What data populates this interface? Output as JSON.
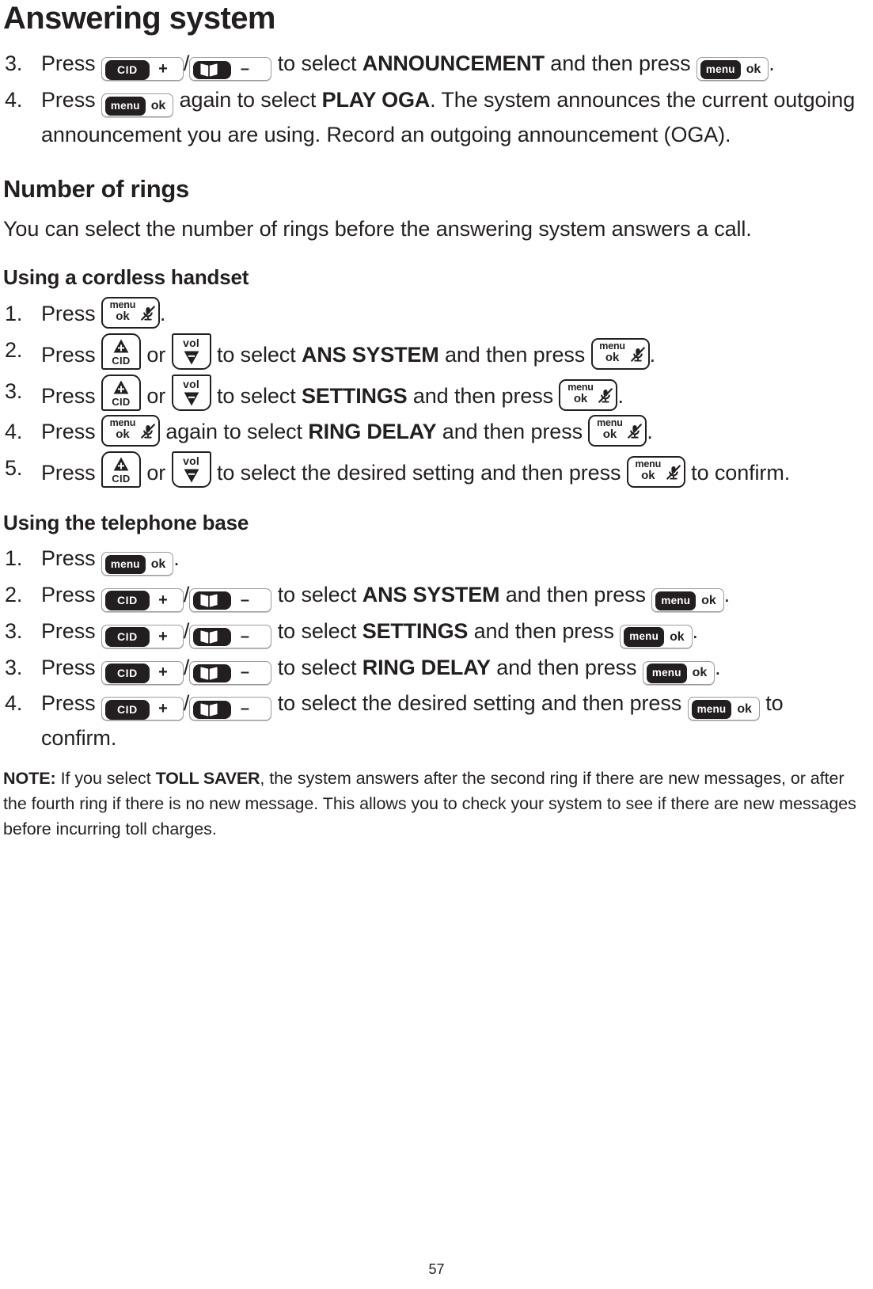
{
  "document": {
    "title": "Answering system",
    "page_number": "57"
  },
  "keys": {
    "base_cid_plus": {
      "chip_label": "CID",
      "sign": "+",
      "name": "base-cid-up-key"
    },
    "base_dir_minus": {
      "chip_icon": "open-book-icon",
      "sign": "–",
      "name": "base-directory-down-key"
    },
    "base_menu_ok": {
      "chip_label": "menu",
      "ok_label": "ok",
      "name": "base-menu-ok-key"
    },
    "handset_menu_ok": {
      "menu_label": "menu",
      "ok_label": "ok",
      "icon": "mute-icon",
      "name": "handset-menu-ok-mute-key"
    },
    "handset_cid_up": {
      "label": "CID",
      "sign": "+",
      "name": "handset-cid-up-key"
    },
    "handset_vol_down": {
      "label": "vol",
      "sign": "–",
      "name": "handset-vol-down-key"
    }
  },
  "announcement_steps": [
    {
      "num": "3.",
      "parts": [
        {
          "t": "text",
          "v": "Press "
        },
        {
          "t": "key",
          "v": "base_cid_plus"
        },
        {
          "t": "text",
          "v": "/"
        },
        {
          "t": "key",
          "v": "base_dir_minus"
        },
        {
          "t": "text",
          "v": " to select "
        },
        {
          "t": "bold",
          "v": "ANNOUNCEMENT"
        },
        {
          "t": "text",
          "v": " and then press "
        },
        {
          "t": "key",
          "v": "base_menu_ok"
        },
        {
          "t": "text",
          "v": "."
        }
      ]
    },
    {
      "num": "4.",
      "parts": [
        {
          "t": "text",
          "v": "Press "
        },
        {
          "t": "key",
          "v": "base_menu_ok"
        },
        {
          "t": "text",
          "v": " again to select "
        },
        {
          "t": "bold",
          "v": "PLAY OGA"
        },
        {
          "t": "text",
          "v": ". The system announces the current outgoing announcement you are using. Record an outgoing announcement (OGA)."
        }
      ]
    }
  ],
  "number_of_rings": {
    "heading": "Number of rings",
    "intro": "You can select the number of rings before the answering system answers a call.",
    "cordless_heading": "Using a cordless handset",
    "base_heading": "Using the telephone base"
  },
  "cordless_steps": [
    {
      "num": "1.",
      "parts": [
        {
          "t": "text",
          "v": "Press "
        },
        {
          "t": "key",
          "v": "handset_menu_ok"
        },
        {
          "t": "text",
          "v": "."
        }
      ]
    },
    {
      "num": "2.",
      "parts": [
        {
          "t": "text",
          "v": "Press "
        },
        {
          "t": "key",
          "v": "handset_cid_up"
        },
        {
          "t": "text",
          "v": " or "
        },
        {
          "t": "key",
          "v": "handset_vol_down"
        },
        {
          "t": "text",
          "v": " to select "
        },
        {
          "t": "bold",
          "v": "ANS SYSTEM"
        },
        {
          "t": "text",
          "v": " and then press "
        },
        {
          "t": "key",
          "v": "handset_menu_ok"
        },
        {
          "t": "text",
          "v": "."
        }
      ]
    },
    {
      "num": "3.",
      "parts": [
        {
          "t": "text",
          "v": "Press "
        },
        {
          "t": "key",
          "v": "handset_cid_up"
        },
        {
          "t": "text",
          "v": " or "
        },
        {
          "t": "key",
          "v": "handset_vol_down"
        },
        {
          "t": "text",
          "v": " to select "
        },
        {
          "t": "bold",
          "v": "SETTINGS"
        },
        {
          "t": "text",
          "v": " and then press "
        },
        {
          "t": "key",
          "v": "handset_menu_ok"
        },
        {
          "t": "text",
          "v": "."
        }
      ]
    },
    {
      "num": "4.",
      "parts": [
        {
          "t": "text",
          "v": "Press "
        },
        {
          "t": "key",
          "v": "handset_menu_ok"
        },
        {
          "t": "text",
          "v": " again to select "
        },
        {
          "t": "bold",
          "v": "RING DELAY"
        },
        {
          "t": "text",
          "v": " and then press "
        },
        {
          "t": "key",
          "v": "handset_menu_ok"
        },
        {
          "t": "text",
          "v": "."
        }
      ]
    },
    {
      "num": "5.",
      "parts": [
        {
          "t": "text",
          "v": "Press "
        },
        {
          "t": "key",
          "v": "handset_cid_up"
        },
        {
          "t": "text",
          "v": " or "
        },
        {
          "t": "key",
          "v": "handset_vol_down"
        },
        {
          "t": "text",
          "v": " to select the desired setting and then press "
        },
        {
          "t": "key",
          "v": "handset_menu_ok"
        },
        {
          "t": "text",
          "v": " to confirm."
        }
      ]
    }
  ],
  "base_steps": [
    {
      "num": "1.",
      "parts": [
        {
          "t": "text",
          "v": "Press "
        },
        {
          "t": "key",
          "v": "base_menu_ok"
        },
        {
          "t": "text",
          "v": "."
        }
      ]
    },
    {
      "num": "2.",
      "parts": [
        {
          "t": "text",
          "v": "Press "
        },
        {
          "t": "key",
          "v": "base_cid_plus"
        },
        {
          "t": "text",
          "v": "/"
        },
        {
          "t": "key",
          "v": "base_dir_minus"
        },
        {
          "t": "text",
          "v": " to select "
        },
        {
          "t": "bold",
          "v": "ANS SYSTEM"
        },
        {
          "t": "text",
          "v": " and then press "
        },
        {
          "t": "key",
          "v": "base_menu_ok"
        },
        {
          "t": "text",
          "v": "."
        }
      ]
    },
    {
      "num": "3.",
      "parts": [
        {
          "t": "text",
          "v": "Press "
        },
        {
          "t": "key",
          "v": "base_cid_plus"
        },
        {
          "t": "text",
          "v": "/"
        },
        {
          "t": "key",
          "v": "base_dir_minus"
        },
        {
          "t": "text",
          "v": " to select "
        },
        {
          "t": "bold",
          "v": "SETTINGS"
        },
        {
          "t": "text",
          "v": " and then press "
        },
        {
          "t": "key",
          "v": "base_menu_ok"
        },
        {
          "t": "text",
          "v": "."
        }
      ]
    },
    {
      "num": "3.",
      "parts": [
        {
          "t": "text",
          "v": "Press "
        },
        {
          "t": "key",
          "v": "base_cid_plus"
        },
        {
          "t": "text",
          "v": "/"
        },
        {
          "t": "key",
          "v": "base_dir_minus"
        },
        {
          "t": "text",
          "v": " to select "
        },
        {
          "t": "bold",
          "v": "RING DELAY"
        },
        {
          "t": "text",
          "v": " and then press "
        },
        {
          "t": "key",
          "v": "base_menu_ok"
        },
        {
          "t": "text",
          "v": "."
        }
      ]
    },
    {
      "num": "4.",
      "parts": [
        {
          "t": "text",
          "v": "Press "
        },
        {
          "t": "key",
          "v": "base_cid_plus"
        },
        {
          "t": "text",
          "v": "/"
        },
        {
          "t": "key",
          "v": "base_dir_minus"
        },
        {
          "t": "text",
          "v": " to select the desired setting and then press "
        },
        {
          "t": "key",
          "v": "base_menu_ok"
        },
        {
          "t": "text",
          "v": " to confirm."
        }
      ]
    }
  ],
  "note": {
    "label": "NOTE:",
    "parts": [
      {
        "t": "text",
        "v": " If you select "
      },
      {
        "t": "bold",
        "v": "TOLL SAVER"
      },
      {
        "t": "text",
        "v": ", the system answers after the second ring if there are new messages, or after the fourth ring if there is no new message. This allows you to check your system to see if there are new messages before incurring toll charges."
      }
    ]
  }
}
